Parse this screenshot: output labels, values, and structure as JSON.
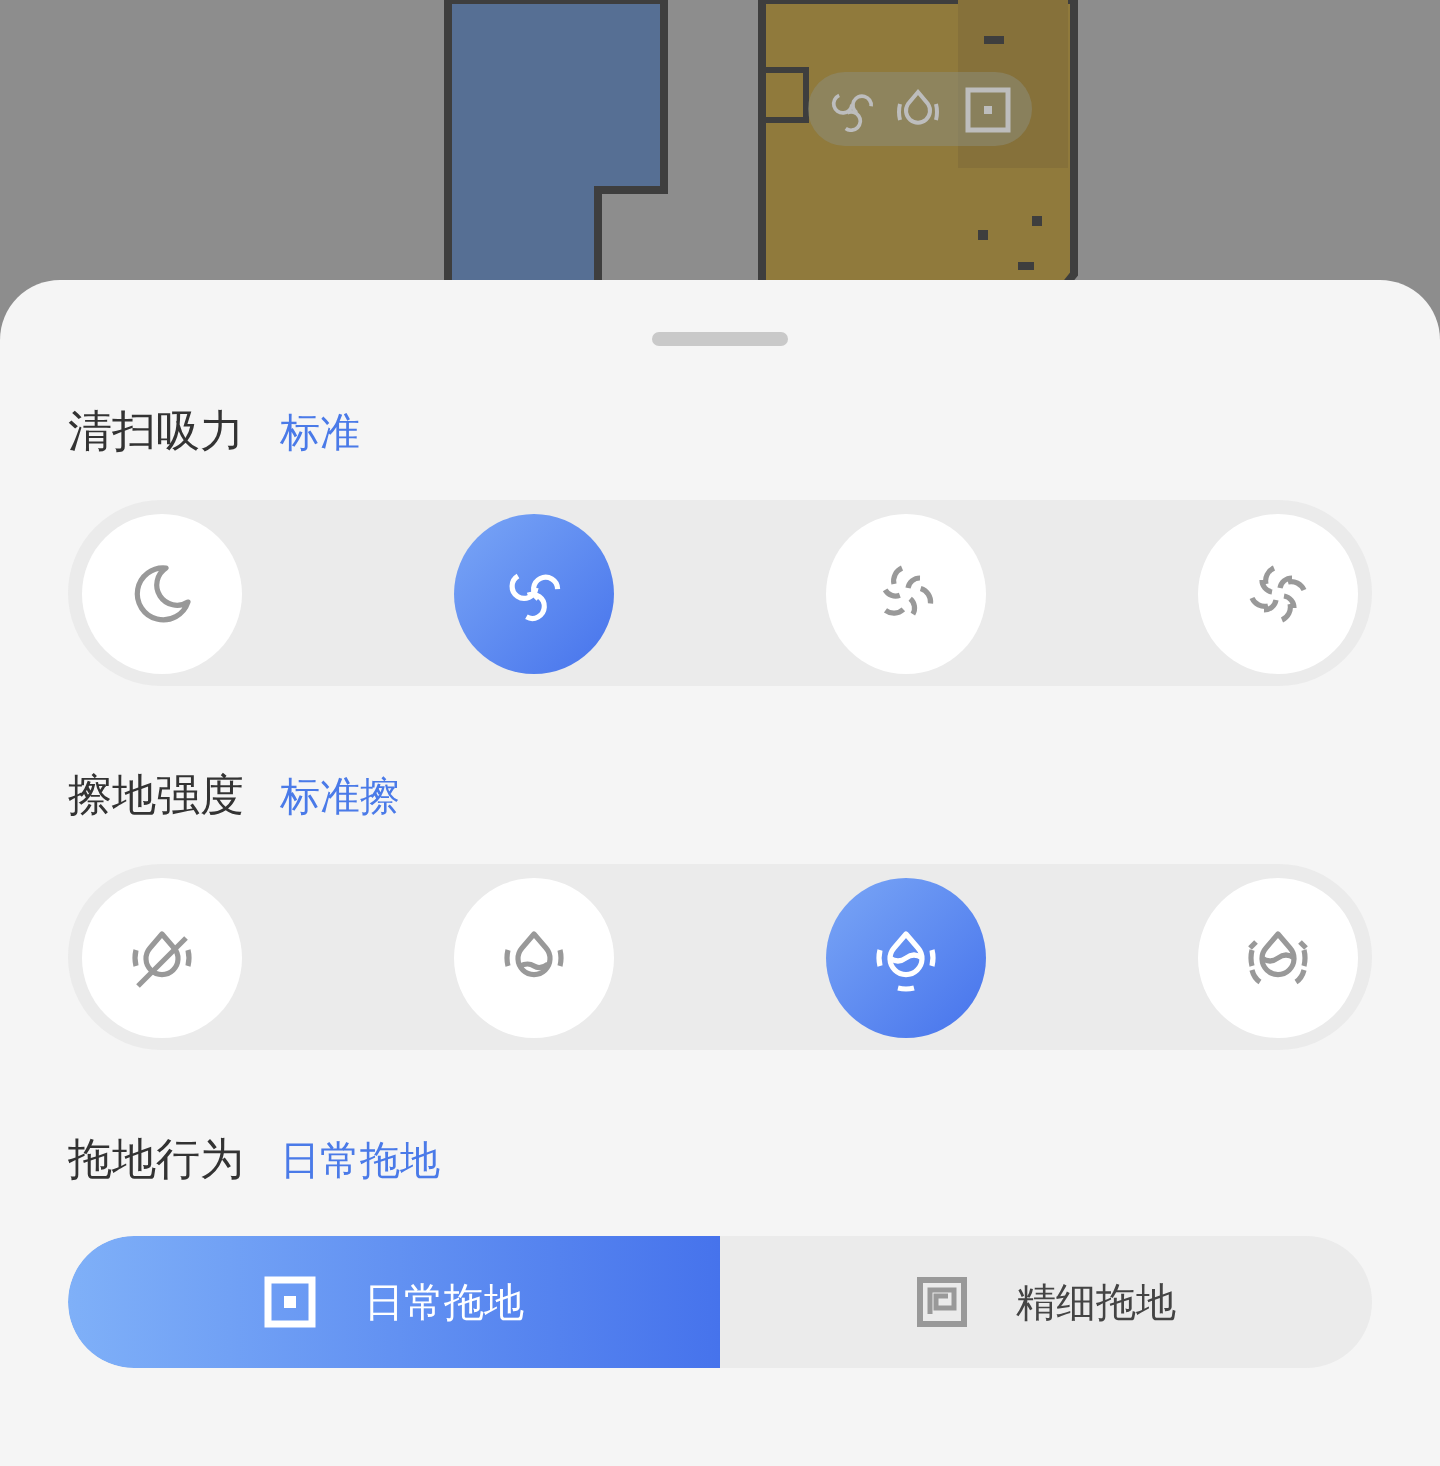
{
  "map": {
    "overlay_icons": [
      {
        "kind": "fan"
      },
      {
        "kind": "drop"
      },
      {
        "kind": "square"
      }
    ]
  },
  "suction": {
    "title": "清扫吸力",
    "value": "标准",
    "options": [
      {
        "kind": "quiet",
        "selected": false
      },
      {
        "kind": "standard",
        "selected": true
      },
      {
        "kind": "strong",
        "selected": false
      },
      {
        "kind": "max",
        "selected": false
      }
    ]
  },
  "mop_intensity": {
    "title": "擦地强度",
    "value": "标准擦",
    "options": [
      {
        "kind": "off",
        "selected": false
      },
      {
        "kind": "low",
        "selected": false
      },
      {
        "kind": "medium",
        "selected": true
      },
      {
        "kind": "high",
        "selected": false
      }
    ]
  },
  "mop_behavior": {
    "title": "拖地行为",
    "value": "日常拖地",
    "options": [
      {
        "kind": "daily",
        "label": "日常拖地",
        "selected": true
      },
      {
        "kind": "fine",
        "label": "精细拖地",
        "selected": false
      }
    ]
  }
}
